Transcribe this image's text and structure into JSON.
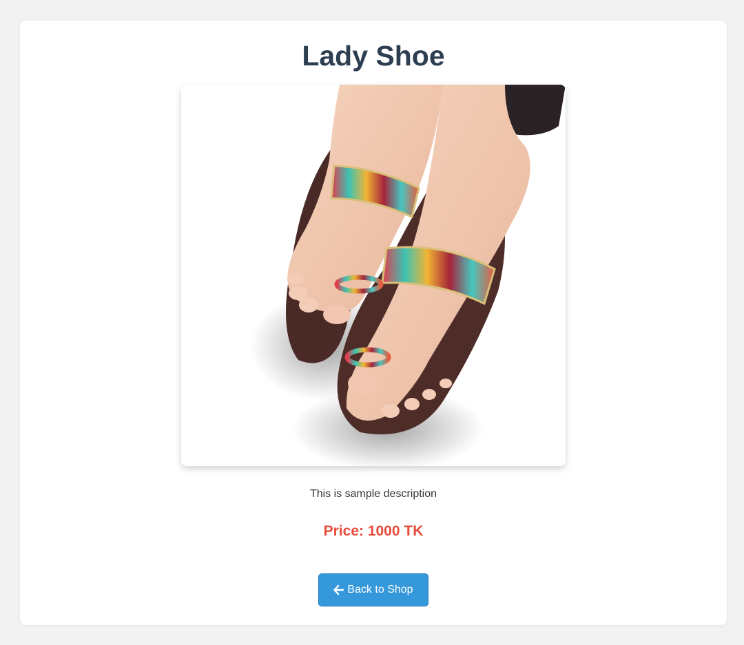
{
  "product": {
    "name": "Lady Shoe",
    "image_alt": "sandal-product-image",
    "description": "This is sample description",
    "price_text": "Price: 1000 TK"
  },
  "actions": {
    "back_label": "Back to Shop",
    "back_icon": "arrow-left-icon"
  },
  "colors": {
    "title": "#2c3e50",
    "price": "#e74c3c",
    "button": "#3498db",
    "page_bg": "#f2f2f2"
  }
}
